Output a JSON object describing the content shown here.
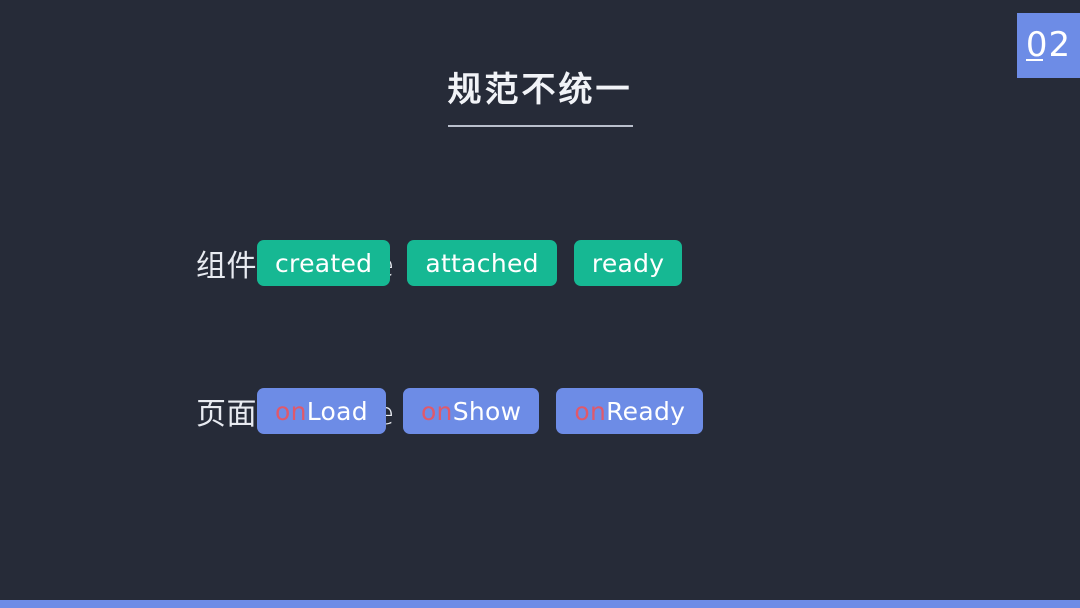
{
  "slide": {
    "background_color": "#262b38",
    "title": "规范不统一"
  },
  "section_badge": {
    "text": "02",
    "color": "#6d8ce6"
  },
  "colors": {
    "background": "#262b38",
    "accent_blue": "#6d8ce6",
    "accent_green": "#16b893",
    "prefix_red": "#e0596b",
    "text_light": "#e8ebf1",
    "underline": "#b9bfcc"
  },
  "rows": [
    {
      "label": "组件 lifecycle",
      "chip_style": "green",
      "chips": [
        {
          "prefix": "",
          "rest": "created"
        },
        {
          "prefix": "",
          "rest": "attached"
        },
        {
          "prefix": "",
          "rest": "ready"
        }
      ]
    },
    {
      "label": "页面 lifecycle",
      "chip_style": "blue",
      "chips": [
        {
          "prefix": "on",
          "rest": "Load"
        },
        {
          "prefix": "on",
          "rest": "Show"
        },
        {
          "prefix": "on",
          "rest": "Ready"
        }
      ]
    }
  ],
  "bottom_bar": {
    "color": "#6d8ce6"
  }
}
